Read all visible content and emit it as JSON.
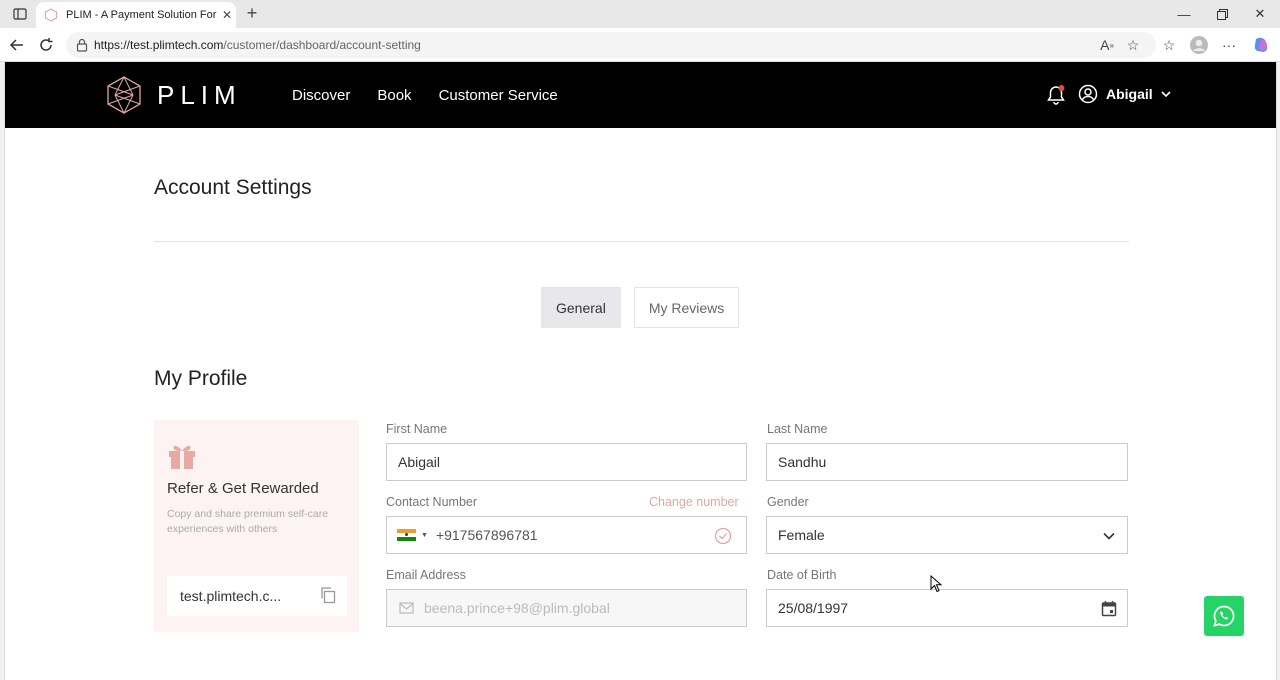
{
  "browser": {
    "tab_title": "PLIM - A Payment Solution For Th",
    "url_host": "https://test.plimtech.com",
    "url_path": "/customer/dashboard/account-setting"
  },
  "header": {
    "logo_text": "PLIM",
    "nav": [
      "Discover",
      "Book",
      "Customer Service"
    ],
    "user_name": "Abigail"
  },
  "page": {
    "title": "Account Settings",
    "tabs": [
      {
        "label": "General",
        "active": true
      },
      {
        "label": "My Reviews",
        "active": false
      }
    ],
    "section_title": "My Profile"
  },
  "refer": {
    "title": "Refer & Get Rewarded",
    "description": "Copy and share premium self-care experiences with others",
    "link": "test.plimtech.c..."
  },
  "form": {
    "first_name": {
      "label": "First Name",
      "value": "Abigail"
    },
    "last_name": {
      "label": "Last Name",
      "value": "Sandhu"
    },
    "contact": {
      "label": "Contact Number",
      "value": "+917567896781",
      "change_label": "Change number"
    },
    "gender": {
      "label": "Gender",
      "value": "Female"
    },
    "email": {
      "label": "Email Address",
      "value": "beena.prince+98@plim.global"
    },
    "dob": {
      "label": "Date of Birth",
      "value": "25/08/1997"
    }
  },
  "colors": {
    "accent": "#e0a7a2",
    "nav_bg": "#000000",
    "whatsapp": "#25d366",
    "refer_bg": "#fdf3f3"
  }
}
